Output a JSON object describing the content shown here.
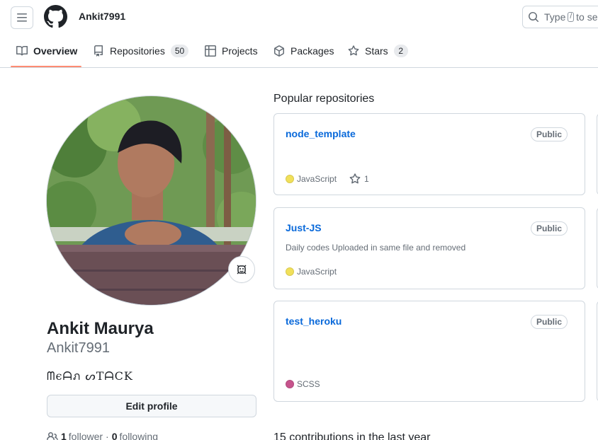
{
  "header": {
    "username": "Ankit7991",
    "search": {
      "text_before": "Type",
      "key": "/",
      "text_after": "to se"
    }
  },
  "tabs": [
    {
      "label": "Overview",
      "icon": "book-icon",
      "selected": true
    },
    {
      "label": "Repositories",
      "icon": "repo-icon",
      "count": "50"
    },
    {
      "label": "Projects",
      "icon": "table-icon"
    },
    {
      "label": "Packages",
      "icon": "package-icon"
    },
    {
      "label": "Stars",
      "icon": "star-icon",
      "count": "2"
    }
  ],
  "profile": {
    "full_name": "Ankit Maurya",
    "login": "Ankit7991",
    "bio": "ᗰєᗩภ ᔕTᗩCK",
    "edit_label": "Edit profile",
    "followers_count": "1",
    "followers_label": "follower",
    "separator": "·",
    "following_count": "0",
    "following_label": "following"
  },
  "popular": {
    "title": "Popular repositories",
    "repos": [
      {
        "name": "node_template",
        "visibility": "Public",
        "description": "",
        "language": "JavaScript",
        "language_color": "#f1e05a",
        "stars": "1"
      },
      {
        "name": "Just-JS",
        "visibility": "Public",
        "description": "Daily codes Uploaded in same file and removed",
        "language": "JavaScript",
        "language_color": "#f1e05a",
        "stars": ""
      },
      {
        "name": "test_heroku",
        "visibility": "Public",
        "description": "",
        "language": "SCSS",
        "language_color": "#c6538c",
        "stars": ""
      }
    ]
  },
  "contributions": {
    "text": "15 contributions in the last year"
  },
  "colors": {
    "accent_link": "#0969da",
    "tab_underline": "#fd8c73",
    "border": "#d0d7de",
    "muted": "#656d76"
  }
}
